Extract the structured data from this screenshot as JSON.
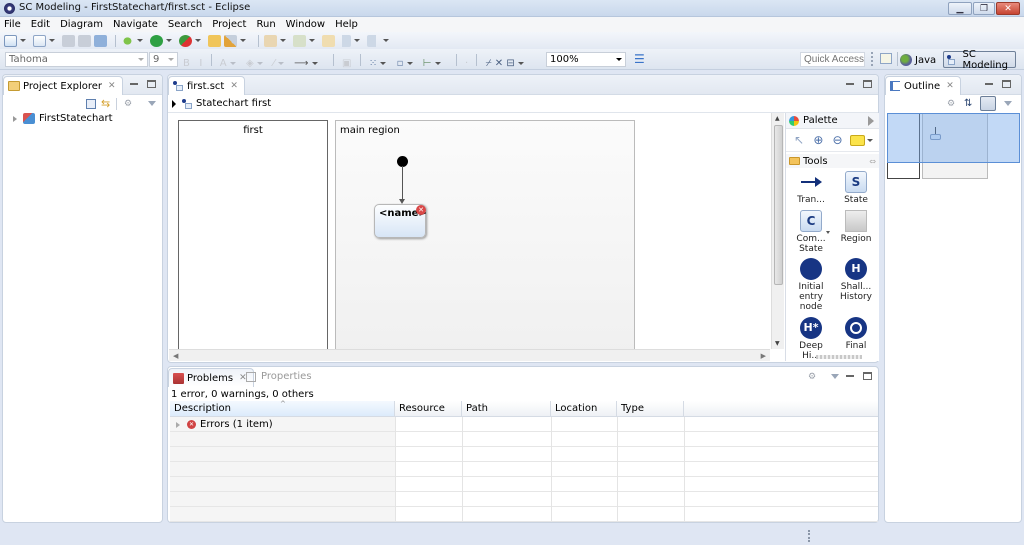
{
  "window": {
    "title": "SC Modeling - FirstStatechart/first.sct - Eclipse",
    "controls": {
      "minimize": "▁",
      "restore": "❐",
      "close": "✕"
    }
  },
  "menu": [
    "File",
    "Edit",
    "Diagram",
    "Navigate",
    "Search",
    "Project",
    "Run",
    "Window",
    "Help"
  ],
  "toolbar": {
    "font_name": "Tahoma",
    "font_size": "9",
    "zoom": "100%",
    "quick_access_placeholder": "Quick Access",
    "perspectives": [
      {
        "label": "Java",
        "active": false
      },
      {
        "label": "SC Modeling",
        "active": true
      }
    ]
  },
  "project_explorer": {
    "title": "Project Explorer",
    "items": [
      {
        "label": "FirstStatechart",
        "expanded": false
      }
    ]
  },
  "editor": {
    "tab": "first.sct",
    "breadcrumb": "Statechart first",
    "definition_section": {
      "title": "first"
    },
    "region": {
      "title": "main region",
      "state": {
        "name": "<name>",
        "has_error": true
      }
    }
  },
  "palette": {
    "title": "Palette",
    "drawer": "Tools",
    "entries": [
      {
        "label": "Tran...",
        "icon": "transition-arrow",
        "glyph": ""
      },
      {
        "label": "State",
        "icon": "state",
        "glyph": "S"
      },
      {
        "label": "Com... State",
        "icon": "composite-state",
        "glyph": "C"
      },
      {
        "label": "Region",
        "icon": "region",
        "glyph": ""
      },
      {
        "label": "Initial entry node",
        "icon": "initial-node",
        "glyph": ""
      },
      {
        "label": "Shall... History",
        "icon": "shallow-history",
        "glyph": "H"
      },
      {
        "label": "Deep Hi...",
        "icon": "deep-history",
        "glyph": "H*"
      },
      {
        "label": "Final",
        "icon": "final-state",
        "glyph": ""
      }
    ]
  },
  "outline": {
    "title": "Outline"
  },
  "problems": {
    "tabs": [
      {
        "label": "Problems",
        "active": true
      },
      {
        "label": "Properties",
        "active": false
      }
    ],
    "summary": "1 error, 0 warnings, 0 others",
    "columns": [
      "Description",
      "Resource",
      "Path",
      "Location",
      "Type"
    ],
    "rows": [
      {
        "description": "Errors (1 item)",
        "severity": "error"
      }
    ]
  },
  "colors": {
    "accent": "#173584",
    "error": "#d04343",
    "frame_bg": "#dfe6f3"
  }
}
